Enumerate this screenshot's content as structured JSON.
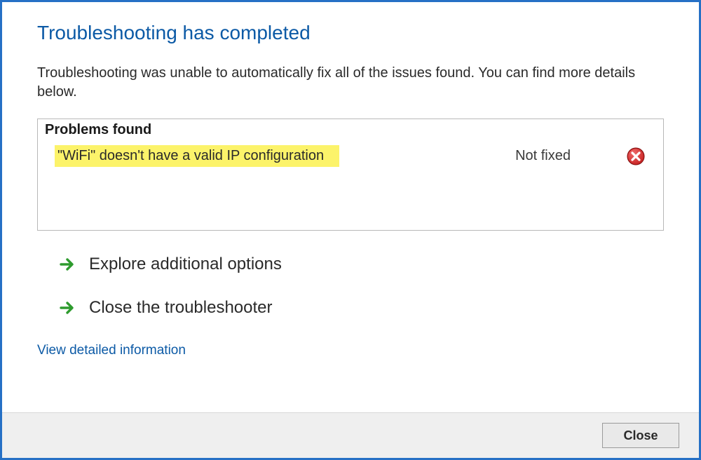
{
  "title": "Troubleshooting has completed",
  "description": "Troubleshooting was unable to automatically fix all of the issues found. You can find more details below.",
  "problems": {
    "header": "Problems found",
    "items": [
      {
        "text": "\"WiFi\" doesn't have a valid IP configuration",
        "status": "Not fixed",
        "icon": "error"
      }
    ]
  },
  "actions": [
    {
      "label": "Explore additional options",
      "icon": "arrow-right"
    },
    {
      "label": "Close the troubleshooter",
      "icon": "arrow-right"
    }
  ],
  "link": "View detailed information",
  "footer": {
    "close_label": "Close"
  },
  "colors": {
    "accent": "#0c5aa6",
    "border": "#2670c5",
    "highlight": "#fcf36a",
    "arrow": "#2e9b2e",
    "error": "#c62121"
  }
}
